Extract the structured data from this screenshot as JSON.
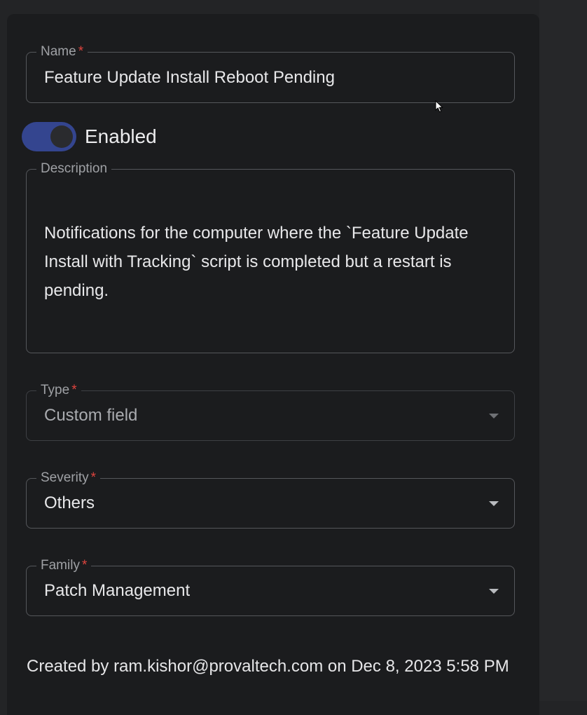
{
  "form": {
    "name": {
      "label": "Name",
      "required_mark": "*",
      "value": "Feature Update Install Reboot Pending"
    },
    "enabled": {
      "label": "Enabled",
      "checked": true
    },
    "description": {
      "label": "Description",
      "value": "Notifications for the computer where the `Feature Update Install with Tracking` script is completed but a restart is pending."
    },
    "type": {
      "label": "Type",
      "required_mark": "*",
      "value": "Custom field"
    },
    "severity": {
      "label": "Severity",
      "required_mark": "*",
      "value": "Others"
    },
    "family": {
      "label": "Family",
      "required_mark": "*",
      "value": "Patch Management"
    }
  },
  "footer": {
    "created_text": "Created by ram.kishor@provaltech.com on Dec 8, 2023 5:58 PM"
  },
  "colors": {
    "accent": "#34458f",
    "required": "#e0443e",
    "background": "#1b1c1e"
  },
  "icons": {
    "dropdown": "chevron-down-icon",
    "cursor": "mouse-pointer-icon"
  }
}
